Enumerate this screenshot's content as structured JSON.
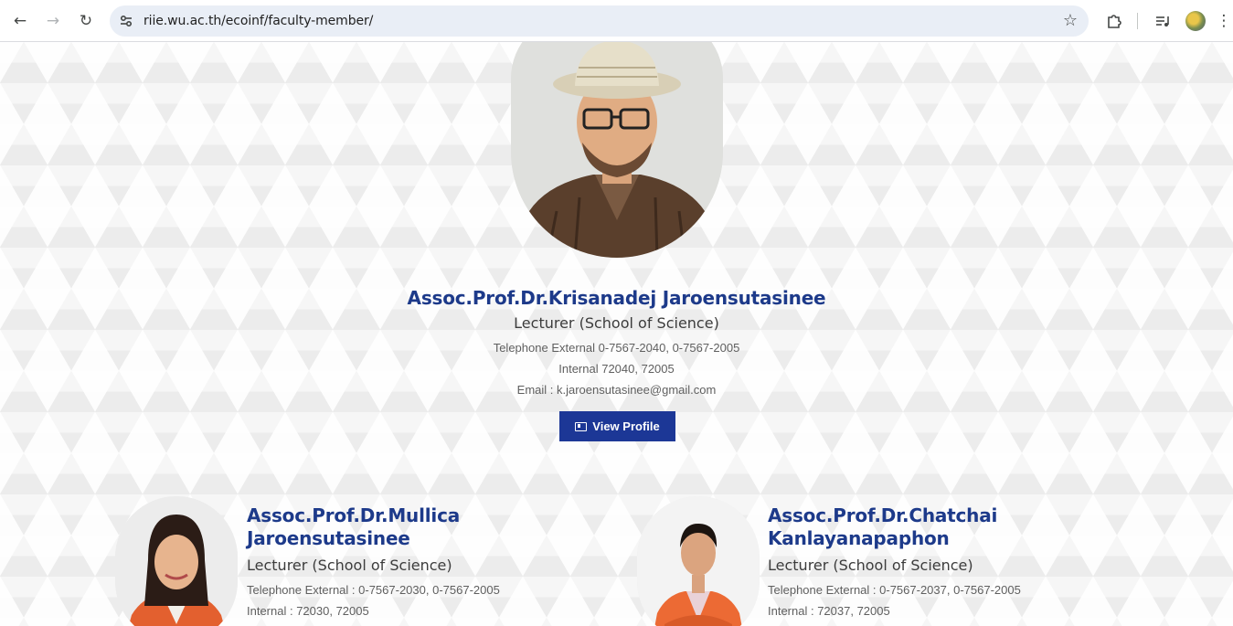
{
  "browser": {
    "url": "riie.wu.ac.th/ecoinf/faculty-member/"
  },
  "featured": {
    "name": "Assoc.Prof.Dr.Krisanadej Jaroensutasinee",
    "role": "Lecturer (School of Science)",
    "telephone": "Telephone External 0-7567-2040, 0-7567-2005",
    "internal": "Internal 72040, 72005",
    "email": "Email : k.jaroensutasinee@gmail.com",
    "button_label": "View Profile"
  },
  "members": [
    {
      "name": "Assoc.Prof.Dr.Mullica Jaroensutasinee",
      "role": "Lecturer (School of Science)",
      "telephone": "Telephone External : 0-7567-2030, 0-7567-2005",
      "internal": "Internal : 72030, 72005"
    },
    {
      "name": "Assoc.Prof.Dr.Chatchai Kanlayanapaphon",
      "role": "Lecturer (School of Science)",
      "telephone": "Telephone External : 0-7567-2037, 0-7567-2005",
      "internal": "Internal : 72037, 72005"
    }
  ],
  "colors": {
    "accent": "#1d3a8a",
    "button": "#1c3796"
  }
}
